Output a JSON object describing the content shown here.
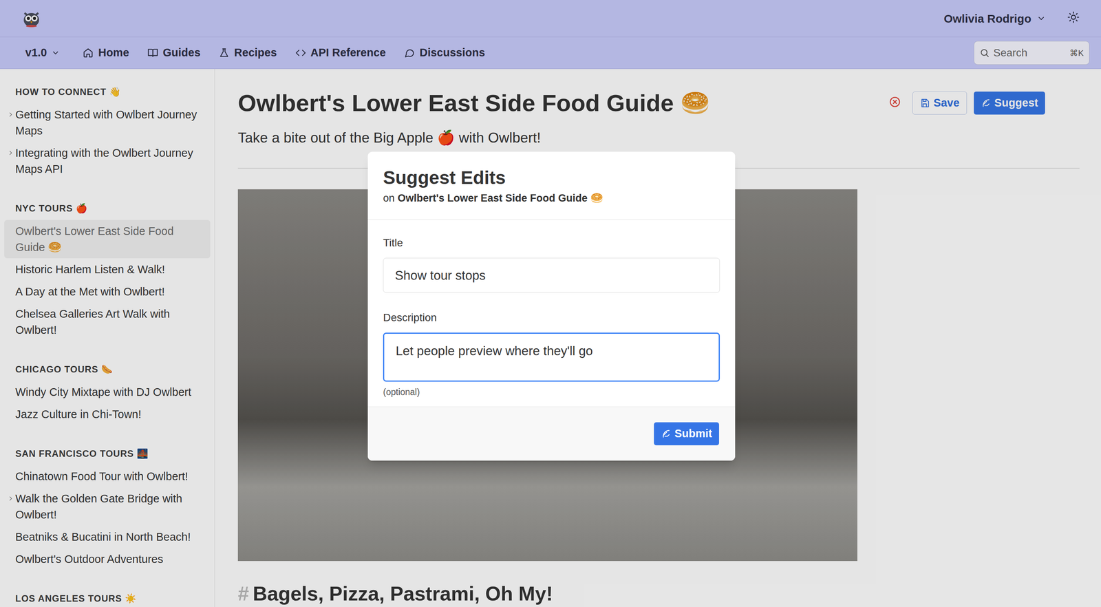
{
  "header": {
    "user": "Owlivia Rodrigo"
  },
  "nav": {
    "version": "v1.0",
    "items": [
      {
        "label": "Home",
        "kind": "home"
      },
      {
        "label": "Guides",
        "kind": "book"
      },
      {
        "label": "Recipes",
        "kind": "flask"
      },
      {
        "label": "API Reference",
        "kind": "code"
      },
      {
        "label": "Discussions",
        "kind": "chat"
      }
    ],
    "search": {
      "placeholder": "Search",
      "shortcut": "⌘K"
    }
  },
  "sidebar": {
    "sections": [
      {
        "title": "HOW TO CONNECT 👋",
        "items": [
          {
            "label": "Getting Started with Owlbert Journey Maps",
            "expandable": true,
            "selected": false
          },
          {
            "label": "Integrating with the Owlbert Journey Maps API",
            "expandable": true,
            "selected": false
          }
        ]
      },
      {
        "title": "NYC TOURS 🍎",
        "items": [
          {
            "label": "Owlbert's Lower East Side Food Guide 🥯",
            "expandable": false,
            "selected": true
          },
          {
            "label": "Historic Harlem Listen & Walk!",
            "expandable": false,
            "selected": false
          },
          {
            "label": "A Day at the Met with Owlbert!",
            "expandable": false,
            "selected": false
          },
          {
            "label": "Chelsea Galleries Art Walk with Owlbert!",
            "expandable": false,
            "selected": false
          }
        ]
      },
      {
        "title": "CHICAGO TOURS 🌭",
        "items": [
          {
            "label": "Windy City Mixtape with DJ Owlbert",
            "expandable": false,
            "selected": false
          },
          {
            "label": "Jazz Culture in Chi-Town!",
            "expandable": false,
            "selected": false
          }
        ]
      },
      {
        "title": "SAN FRANCISCO TOURS 🌉",
        "items": [
          {
            "label": "Chinatown Food Tour with Owlbert!",
            "expandable": false,
            "selected": false
          },
          {
            "label": "Walk the Golden Gate Bridge with Owlbert!",
            "expandable": true,
            "selected": false
          },
          {
            "label": "Beatniks & Bucatini in North Beach!",
            "expandable": false,
            "selected": false
          },
          {
            "label": "Owlbert's Outdoor Adventures",
            "expandable": false,
            "selected": false
          }
        ]
      },
      {
        "title": "LOS ANGELES TOURS ☀️",
        "items": []
      }
    ]
  },
  "page": {
    "title": "Owlbert's Lower East Side Food Guide 🥯",
    "subtitle": "Take a bite out of the Big Apple 🍎 with Owlbert!",
    "save": "Save",
    "suggest": "Suggest",
    "anchor": "#",
    "heading": "Bagels, Pizza, Pastrami, Oh My!"
  },
  "modal": {
    "title": "Suggest Edits",
    "prefix": "on",
    "doc": "Owlbert's Lower East Side Food Guide 🥯",
    "fields": [
      {
        "label": "Title",
        "value": "Show tour stops",
        "focused": false,
        "hint": ""
      },
      {
        "label": "Description",
        "value": "Let people preview where they'll go",
        "focused": true,
        "hint": "(optional)"
      }
    ],
    "submit": "Submit"
  }
}
